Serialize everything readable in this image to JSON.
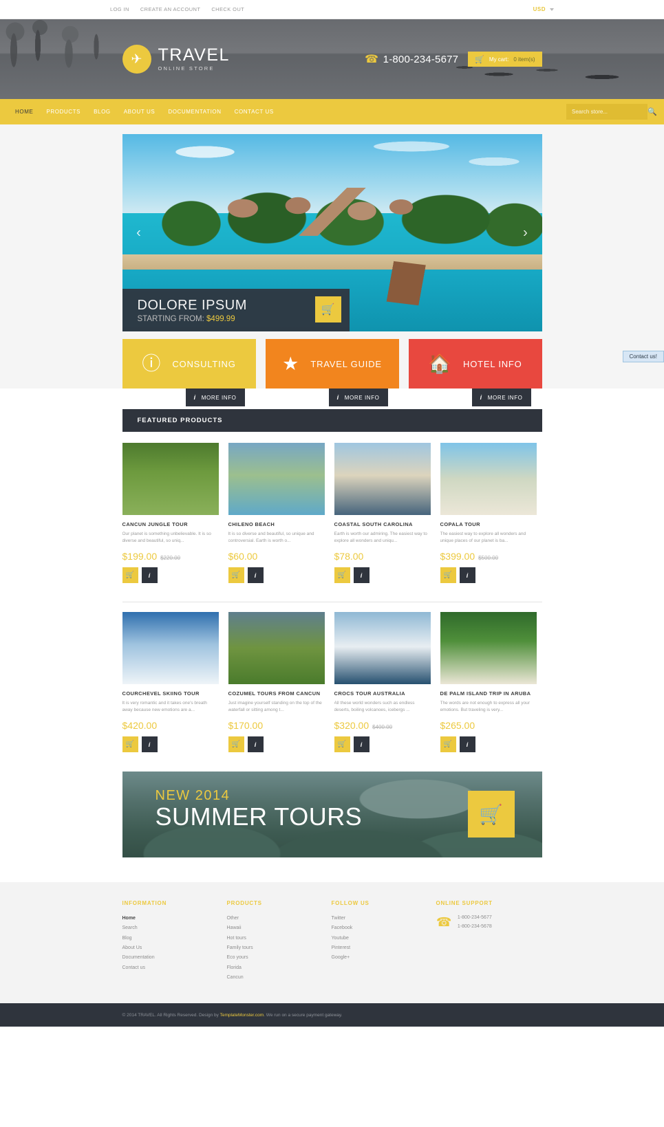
{
  "topbar": {
    "links": [
      {
        "label": "LOG IN"
      },
      {
        "label": "CREATE AN ACCOUNT"
      },
      {
        "label": "CHECK OUT"
      }
    ],
    "currency": "USD"
  },
  "header": {
    "logo_title": "TRAVEL",
    "logo_sub": "ONLINE STORE",
    "logo_icon": "airplane-icon",
    "phone": "1-800-234-5677",
    "phone_icon": "phone-icon",
    "cart_icon": "cart-icon",
    "cart_label": "My cart:",
    "cart_count": "0 item(s)"
  },
  "nav": {
    "items": [
      {
        "label": "HOME",
        "active": true
      },
      {
        "label": "PRODUCTS",
        "active": false
      },
      {
        "label": "BLOG",
        "active": false
      },
      {
        "label": "ABOUT US",
        "active": false
      },
      {
        "label": "DOCUMENTATION",
        "active": false
      },
      {
        "label": "CONTACT US",
        "active": false
      }
    ],
    "search_placeholder": "Search store...",
    "search_icon": "search-icon"
  },
  "slider": {
    "prev_icon": "chevron-left-icon",
    "next_icon": "chevron-right-icon",
    "caption_title": "DOLORE IPSUM",
    "caption_prefix": "STARTING FROM:",
    "caption_price": "$499.99",
    "caption_cart_icon": "cart-icon"
  },
  "features": [
    {
      "label": "CONSULTING",
      "icon": "info-circle-icon",
      "glyph": "ℹ",
      "color": "#ecc93f",
      "button": "MORE INFO"
    },
    {
      "label": "TRAVEL GUIDE",
      "icon": "star-icon",
      "glyph": "★",
      "color": "#f2851e",
      "button": "MORE INFO"
    },
    {
      "label": "HOTEL INFO",
      "icon": "home-icon",
      "glyph": "⌂",
      "color": "#e8483f",
      "button": "MORE INFO"
    }
  ],
  "featured": {
    "heading": "FEATURED PRODUCTS",
    "cart_icon": "cart-icon",
    "info_icon": "info-icon",
    "products": [
      {
        "title": "CANCUN JUNGLE TOUR",
        "desc": "Our planet is something unbelievable. It is so diverse and beautiful, so uniq...",
        "price": "$199.00",
        "old_price": "$220.00",
        "img": "flamingos-in-green-lagoon"
      },
      {
        "title": "CHILENO BEACH",
        "desc": "It is so diverse and beautiful, so unique and controversial. Earth is worth o...",
        "price": "$60.00",
        "old_price": "",
        "img": "coastal-resort-aerial"
      },
      {
        "title": "COASTAL SOUTH CAROLINA",
        "desc": "Earth is worth our admiring. The easiest way to explore all wonders and uniqu...",
        "price": "$78.00",
        "old_price": "",
        "img": "marina-with-boats"
      },
      {
        "title": "COPALA TOUR",
        "desc": "The easiest way to explore all wonders and unique places of our planet is ba...",
        "price": "$399.00",
        "old_price": "$500.00",
        "img": "white-sand-beach-huts"
      },
      {
        "title": "COURCHEVEL SKIING TOUR",
        "desc": "It is very romantic and it takes one's breath away because new emotions are a...",
        "price": "$420.00",
        "old_price": "",
        "img": "snowboarder-on-snow"
      },
      {
        "title": "COZUMEL TOURS FROM CANCUN",
        "desc": "Just imagine yourself standing on the top of the waterfall or sitting among t...",
        "price": "$170.00",
        "old_price": "",
        "img": "green-hills-harbour"
      },
      {
        "title": "CROCS TOUR AUSTRALIA",
        "desc": "All these world wonders such as endless deserts, boiling volcanoes, icebergs ...",
        "price": "$320.00",
        "old_price": "$400.00",
        "img": "sydney-opera-house"
      },
      {
        "title": "DE PALM ISLAND TRIP IN ARUBA",
        "desc": "The words are not enough to express all your emotions. But traveling is very...",
        "price": "$265.00",
        "old_price": "",
        "img": "palm-trees-white-beach"
      }
    ]
  },
  "promo": {
    "line1": "NEW 2014",
    "line2": "SUMMER TOURS",
    "cart_icon": "cart-icon"
  },
  "footer": {
    "columns": [
      {
        "heading": "INFORMATION",
        "links": [
          {
            "label": "Home",
            "current": true
          },
          {
            "label": "Search",
            "current": false
          },
          {
            "label": "Blog",
            "current": false
          },
          {
            "label": "About Us",
            "current": false
          },
          {
            "label": "Documentation",
            "current": false
          },
          {
            "label": "Contact us",
            "current": false
          }
        ]
      },
      {
        "heading": "PRODUCTS",
        "links": [
          {
            "label": "Other",
            "current": false
          },
          {
            "label": "Hawaii",
            "current": false
          },
          {
            "label": "Hot tours",
            "current": false
          },
          {
            "label": "Family tours",
            "current": false
          },
          {
            "label": "Eco yours",
            "current": false
          },
          {
            "label": "Florida",
            "current": false
          },
          {
            "label": "Cancun",
            "current": false
          }
        ]
      },
      {
        "heading": "FOLLOW US",
        "links": [
          {
            "label": "Twitter",
            "current": false
          },
          {
            "label": "Facebook",
            "current": false
          },
          {
            "label": "Youtube",
            "current": false
          },
          {
            "label": "Pinterest",
            "current": false
          },
          {
            "label": "Google+",
            "current": false
          }
        ]
      }
    ],
    "support": {
      "heading": "ONLINE SUPPORT",
      "icon": "phone-icon",
      "phone1": "1-800-234-5677",
      "phone2": "1-800-234-5678"
    },
    "copyright_pre": "© 2014 TRAVEL. All Rights Reserved. Design by ",
    "copyright_link": "TemplateMonster.com",
    "copyright_post": ". We run on a secure payment gateway."
  },
  "contact_tab": {
    "label": "Contact us!"
  }
}
